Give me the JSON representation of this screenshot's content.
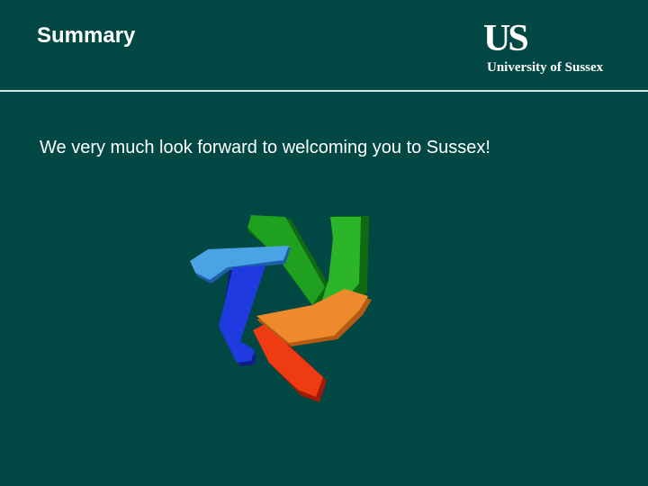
{
  "slide": {
    "title": "Summary",
    "message": "We very much look forward to welcoming you to Sussex!"
  },
  "logo": {
    "mark": "US",
    "name": "University of Sussex"
  },
  "graphic": {
    "arms": [
      {
        "color_name": "green",
        "face": "#1fa01f",
        "shade": "#0f6a12"
      },
      {
        "color_name": "light-blue",
        "face": "#4aa3e4",
        "shade": "#1e5ea8"
      },
      {
        "color_name": "blue",
        "face": "#1f3be0",
        "shade": "#0e1f8a"
      },
      {
        "color_name": "red",
        "face": "#ef3b12",
        "shade": "#a01c06"
      },
      {
        "color_name": "orange",
        "face": "#ee8a2c",
        "shade": "#b55a12"
      }
    ]
  },
  "colors": {
    "background": "#014845",
    "text": "#ffffff",
    "divider": "#d8e6e4"
  }
}
